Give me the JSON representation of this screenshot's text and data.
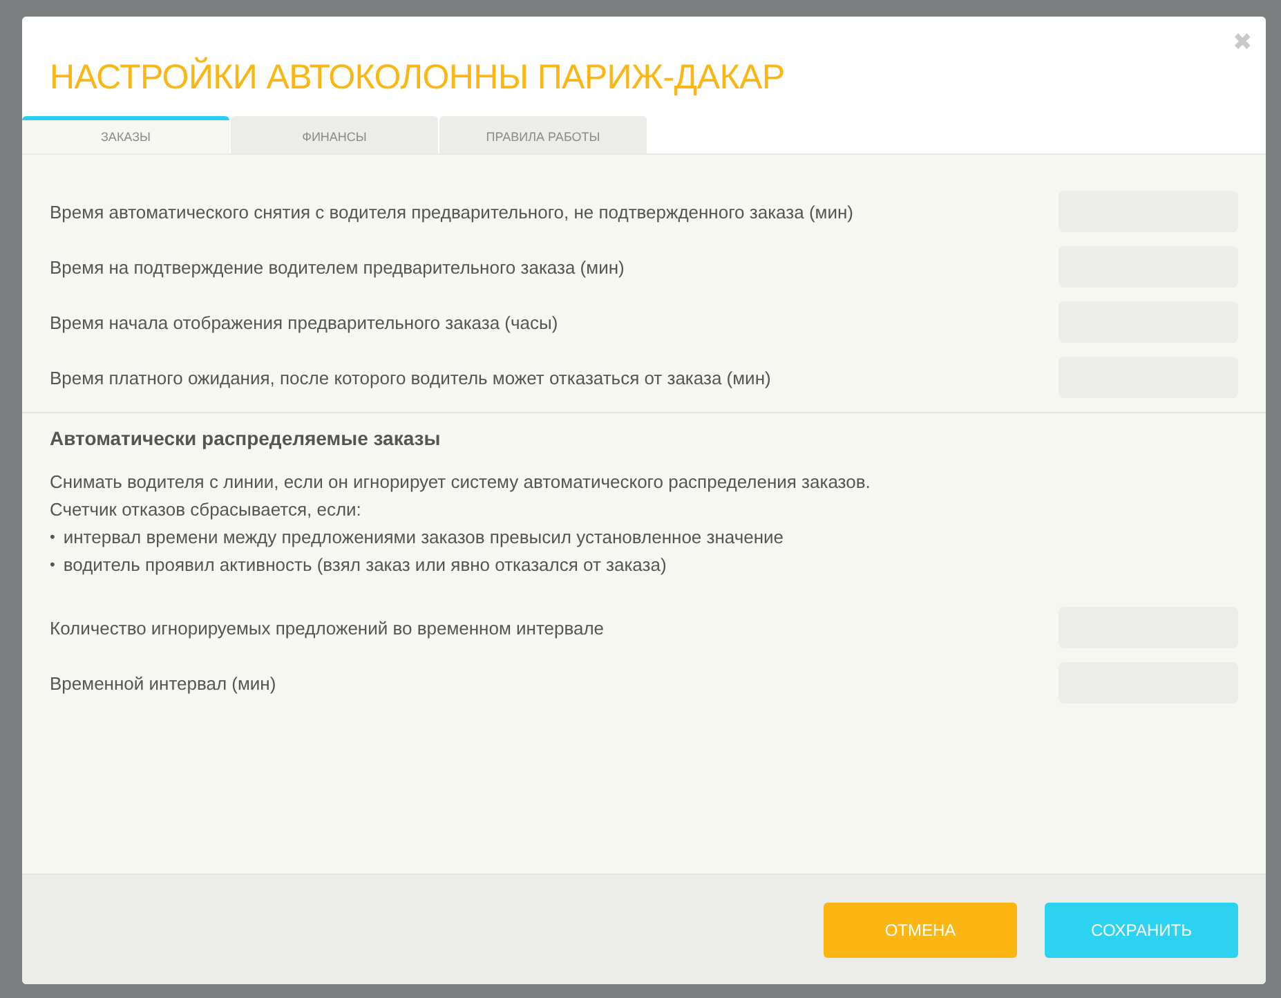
{
  "dialog": {
    "title": "НАСТРОЙКИ АВТОКОЛОННЫ ПАРИЖ-ДАКАР",
    "close": "✖"
  },
  "tabs": [
    {
      "label": "ЗАКАЗЫ",
      "selected": true
    },
    {
      "label": "ФИНАНСЫ",
      "selected": false
    },
    {
      "label": "ПРАВИЛА РАБОТЫ",
      "selected": false
    }
  ],
  "fields": [
    {
      "label": "Время автоматического снятия с водителя предварительного, не подтвержденного заказа (мин)"
    },
    {
      "label": "Время на подтверждение водителем предварительного заказа (мин)"
    },
    {
      "label": "Время начала отображения предварительного заказа (часы)"
    },
    {
      "label": "Время платного ожидания, после которого водитель может отказаться от заказа (мин)"
    }
  ],
  "auto_section": {
    "title": "Автоматически распределяемые заказы",
    "lines": [
      "Снимать водителя с линии, если он игнорирует систему автоматического распределения заказов.",
      "Счетчик отказов сбрасывается, если:"
    ],
    "bullets": [
      {
        "mark": "•",
        "text": "интервал времени между предложениями заказов превысил установленное значение"
      },
      {
        "mark": "•",
        "text": "водитель проявил активность (взял заказ или явно отказался от заказа)"
      }
    ],
    "fields": [
      {
        "label": "Количество игнорируемых предложений во временном интервале"
      },
      {
        "label": "Временной интервал  (мин)"
      }
    ]
  },
  "buttons": [
    {
      "kind": "cancel",
      "label": "ОТМЕНА"
    },
    {
      "kind": "save",
      "label": "СОХРАНИТЬ"
    }
  ]
}
